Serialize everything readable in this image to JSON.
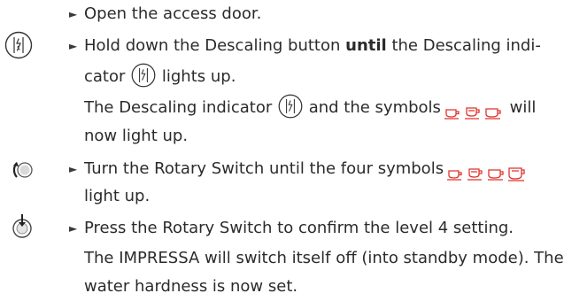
{
  "steps": {
    "open_door": "Open the access door.",
    "hold_prefix": "Hold down the Descaling button ",
    "hold_bold": "until",
    "hold_suffix": " the Descaling indi-",
    "cator_pre": "cator",
    "cator_post": " lights up.",
    "indicator_pre": "The Descaling indicator",
    "indicator_post": " and the symbols",
    "indicator_end": " will",
    "now_light": "now light up.",
    "turn_line1": "Turn the Rotary Switch until the four symbols",
    "turn_line2": "light up.",
    "press_line1": "Press the Rotary Switch to confirm the level 4 setting.",
    "press_line2": "The IMPRESSA will switch itself off (into standby mode). The",
    "press_line3": "water hardness is now set."
  },
  "bullet_glyph": "►",
  "colors": {
    "text": "#2b2b2b",
    "cup_symbol": "#e0322b",
    "icon_stroke": "#333333"
  },
  "icons": {
    "descaling": "descaling-button-icon",
    "rotary_turn": "rotary-switch-turn-icon",
    "rotary_press": "rotary-switch-press-icon",
    "cup": "cup-symbol-icon"
  }
}
